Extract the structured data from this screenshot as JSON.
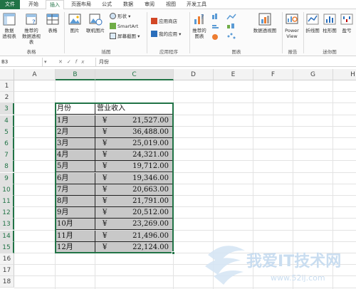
{
  "ribbon_tabs": [
    "文件",
    "开始",
    "插入",
    "页面布局",
    "公式",
    "数据",
    "审阅",
    "视图",
    "开发工具"
  ],
  "ribbon": {
    "tables_group": {
      "label": "表格",
      "pivot_table": "数据\n透视表",
      "recommended_pivot": "推荐的\n数据透视表",
      "table": "表格"
    },
    "illustrations_group": {
      "label": "插图",
      "pictures": "图片",
      "online_pictures": "联机图片",
      "shapes": "形状",
      "smartart": "SmartArt",
      "screenshot": "屏幕截图"
    },
    "apps_group": {
      "label": "应用程序",
      "store": "应用商店",
      "my_apps": "我的应用"
    },
    "charts_group": {
      "label": "图表",
      "recommended_charts": "推荐的\n图表",
      "pivot_chart": "数据透视图"
    },
    "reports_group": {
      "label": "报告",
      "power_view": "Power\nView"
    },
    "sparklines_group": {
      "label": "迷你图",
      "line": "折线图",
      "column": "柱形图",
      "winloss": "盈亏"
    }
  },
  "formula_bar": {
    "name_box": "B3",
    "fx": "fx",
    "value": "月份"
  },
  "columns": [
    "A",
    "B",
    "C",
    "D",
    "E",
    "F",
    "G",
    "H"
  ],
  "rows": [
    "1",
    "2",
    "3",
    "4",
    "5",
    "6",
    "7",
    "8",
    "9",
    "10",
    "11",
    "12",
    "13",
    "14",
    "15",
    "16",
    "17",
    "18"
  ],
  "table": {
    "header": [
      "月份",
      "营业收入"
    ],
    "currency_symbol": "¥",
    "data": [
      [
        "1月",
        "21,527.00"
      ],
      [
        "2月",
        "36,488.00"
      ],
      [
        "3月",
        "25,019.00"
      ],
      [
        "4月",
        "24,321.00"
      ],
      [
        "5月",
        "19,712.00"
      ],
      [
        "6月",
        "19,346.00"
      ],
      [
        "7月",
        "20,663.00"
      ],
      [
        "8月",
        "21,791.00"
      ],
      [
        "9月",
        "20,512.00"
      ],
      [
        "10月",
        "23,269.00"
      ],
      [
        "11月",
        "21,496.00"
      ],
      [
        "12月",
        "22,124.00"
      ]
    ]
  },
  "watermark": {
    "text": "我爱IT技术网",
    "url": "www.52ij.com"
  },
  "colors": {
    "excel_green": "#217346",
    "selection_fill": "#c8c8c8",
    "watermark": "#c9ddf0"
  }
}
